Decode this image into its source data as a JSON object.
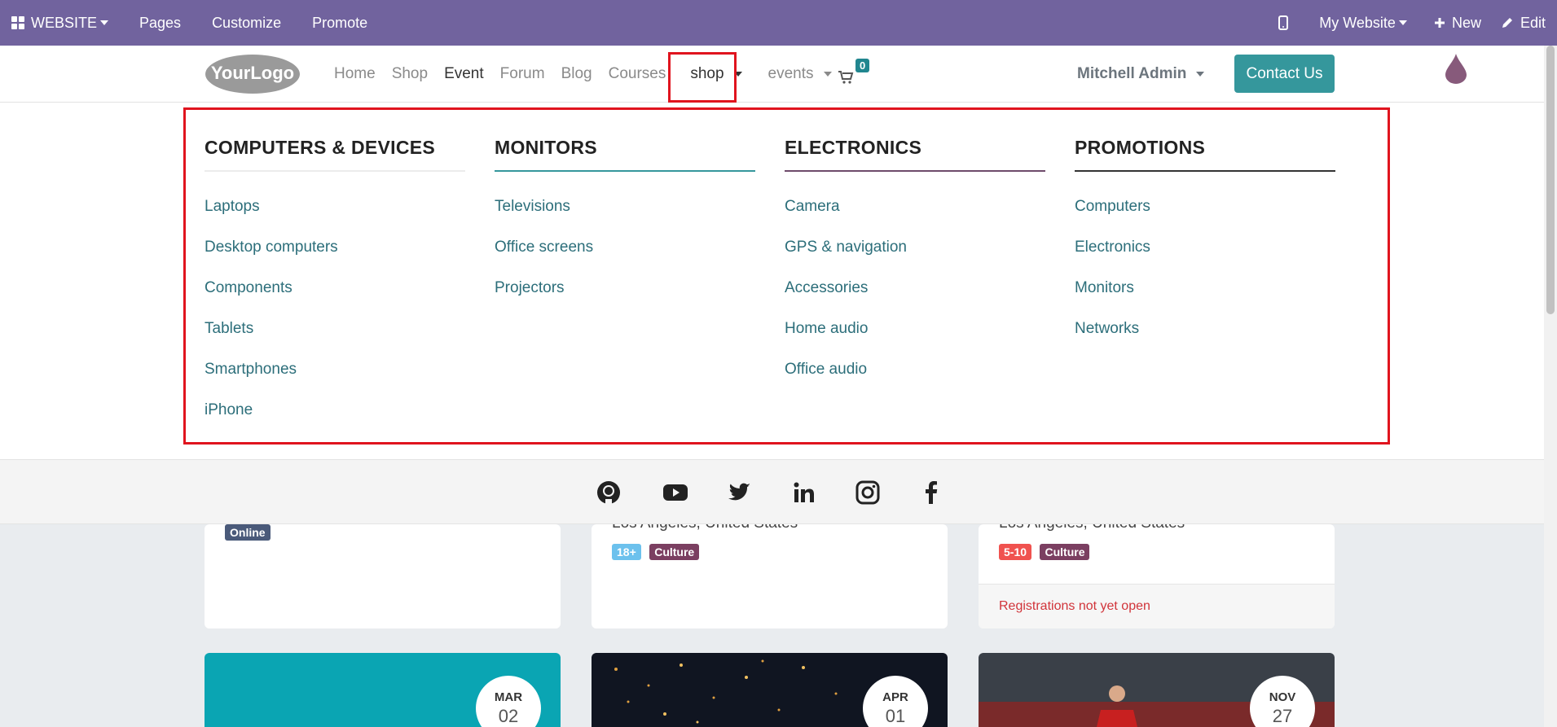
{
  "admin_bar": {
    "website_label": "WEBSITE",
    "pages_label": "Pages",
    "customize_label": "Customize",
    "promote_label": "Promote",
    "site_selector": "My Website",
    "new_label": "New",
    "edit_label": "Edit",
    "background": "#71639e"
  },
  "header": {
    "logo_text": "YourLogo",
    "nav": [
      "Home",
      "Shop",
      "Event",
      "Forum",
      "Blog",
      "Courses"
    ],
    "active_nav": "Event",
    "shop_dropdown": "shop",
    "events_dropdown": "events",
    "cart_count": "0",
    "user_name": "Mitchell Admin",
    "contact_button": "Contact Us",
    "accent": "#35979c"
  },
  "mega_menu": {
    "columns": [
      {
        "title": "COMPUTERS & DEVICES",
        "underline_color": "#ececec",
        "items": [
          "Laptops",
          "Desktop computers",
          "Components",
          "Tablets",
          "Smartphones",
          "iPhone"
        ]
      },
      {
        "title": "MONITORS",
        "underline_color": "#35979c",
        "items": [
          "Televisions",
          "Office screens",
          "Projectors"
        ]
      },
      {
        "title": "ELECTRONICS",
        "underline_color": "#6e4b6b",
        "items": [
          "Camera",
          "GPS & navigation",
          "Accessories",
          "Home audio",
          "Office audio"
        ]
      },
      {
        "title": "PROMOTIONS",
        "underline_color": "#333333",
        "items": [
          "Computers",
          "Electronics",
          "Monitors",
          "Networks"
        ]
      }
    ]
  },
  "social_icons": [
    "github-icon",
    "youtube-icon",
    "twitter-icon",
    "linkedin-icon",
    "instagram-icon",
    "facebook-icon"
  ],
  "event_cards": [
    {
      "location": "",
      "tags": [
        {
          "label": "Online",
          "color": "#4a5a7a"
        }
      ],
      "footer": ""
    },
    {
      "location": "Los Angeles, United States",
      "tags": [
        {
          "label": "18+",
          "color": "#6cc1ed"
        },
        {
          "label": "Culture",
          "color": "#7b3f61"
        }
      ],
      "footer": ""
    },
    {
      "location": "Los Angeles, United States",
      "tags": [
        {
          "label": "5-10",
          "color": "#f0524f"
        },
        {
          "label": "Culture",
          "color": "#7b3f61"
        }
      ],
      "footer": "Registrations not yet open"
    }
  ],
  "upcoming": [
    {
      "month": "MAR",
      "day": "02",
      "bg": "#0aa5b3"
    },
    {
      "month": "APR",
      "day": "01",
      "bg": "#101521"
    },
    {
      "month": "NOV",
      "day": "27",
      "bg": "#3a4048"
    }
  ]
}
